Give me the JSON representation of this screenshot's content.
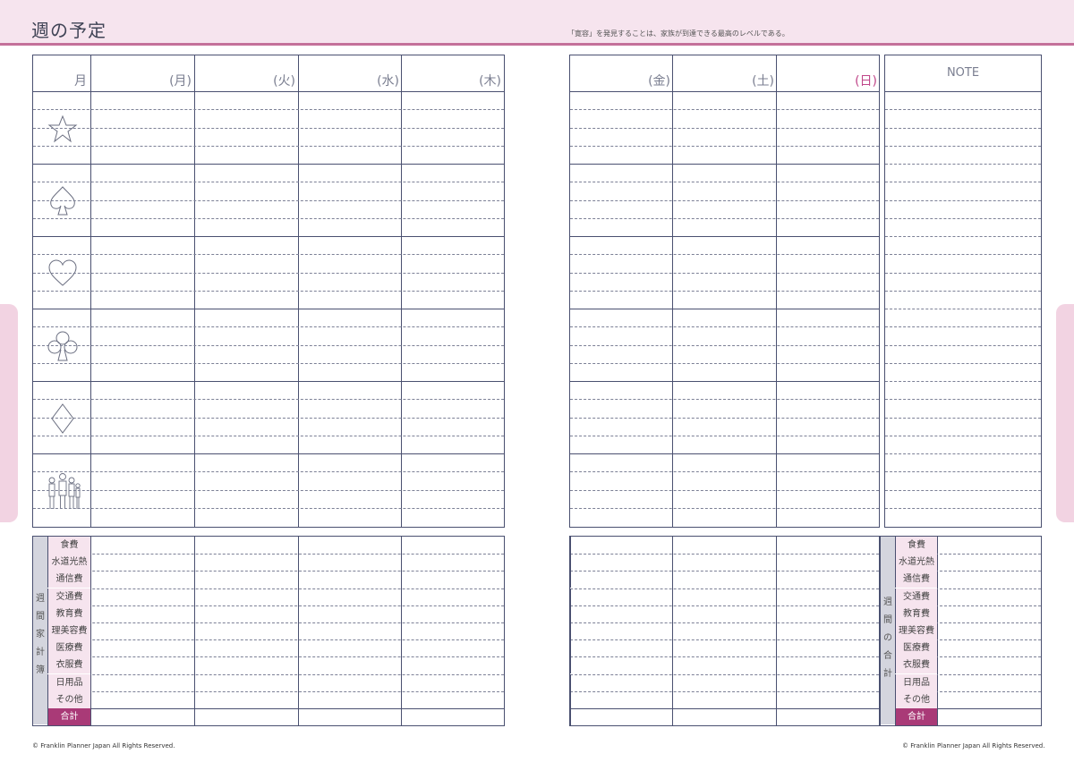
{
  "header": {
    "title": "週の予定",
    "quote": "「寛容」を発見することは、家族が到達できる最高のレベルである。"
  },
  "left_page": {
    "month_label": "月",
    "days": [
      "(月)",
      "(火)",
      "(水)",
      "(木)"
    ],
    "icons": [
      "star-icon",
      "spade-icon",
      "heart-icon",
      "club-icon",
      "diamond-icon",
      "family-icon"
    ],
    "budget_title": [
      "週",
      "間",
      "家",
      "計",
      "簿"
    ],
    "budget_categories": [
      "食費",
      "水道光熱費",
      "通信費",
      "交通費",
      "教育費",
      "理美容費",
      "医療費",
      "衣服費",
      "日用品",
      "その他",
      "合計"
    ]
  },
  "right_page": {
    "days": [
      "(金)",
      "(土)",
      "(日)"
    ],
    "note_label": "NOTE",
    "budget_title": [
      "週",
      "間",
      "の",
      "合",
      "計"
    ],
    "budget_categories": [
      "食費",
      "水道光熱費",
      "通信費",
      "交通費",
      "教育費",
      "理美容費",
      "医療費",
      "衣服費",
      "日用品",
      "その他",
      "合計"
    ]
  },
  "footer": {
    "copyright_left": "© Franklin Planner Japan All Rights Reserved.",
    "copyright_right": "© Franklin Planner Japan All Rights Reserved."
  },
  "colors": {
    "header_bg": "#f6e4ee",
    "accent": "#c4709a",
    "line": "#4a5070",
    "sunday": "#c0478a",
    "total_bg": "#a93a77"
  }
}
